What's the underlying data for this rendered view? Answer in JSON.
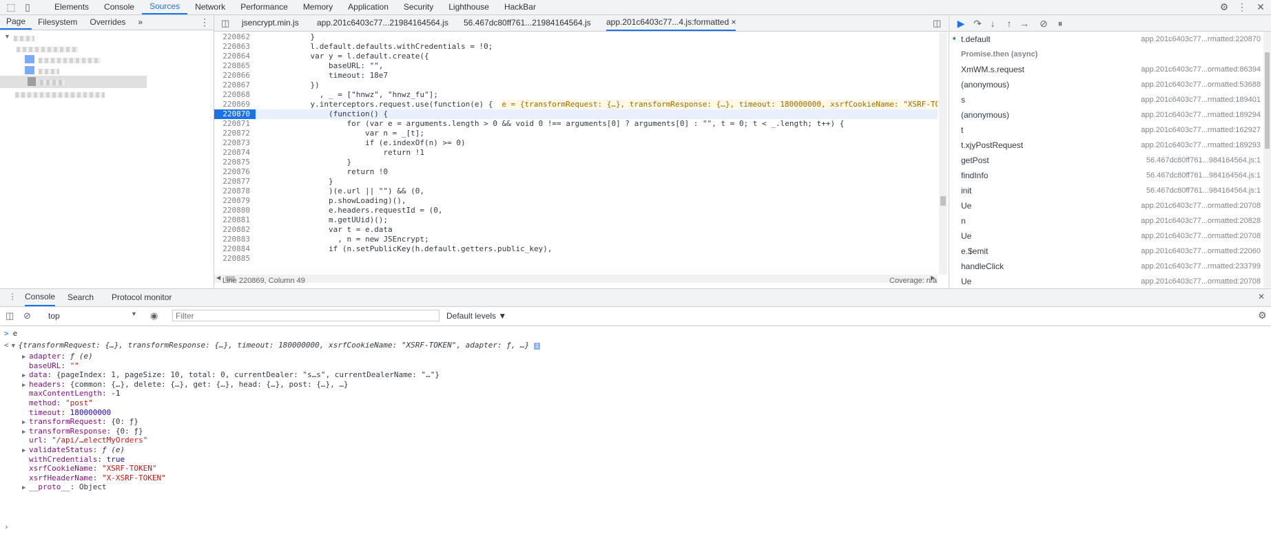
{
  "top_tabs": [
    "Elements",
    "Console",
    "Sources",
    "Network",
    "Performance",
    "Memory",
    "Application",
    "Security",
    "Lighthouse",
    "HackBar"
  ],
  "active_top_tab": "Sources",
  "navigator": {
    "tabs": [
      "Page",
      "Filesystem",
      "Overrides",
      "»"
    ],
    "active": "Page"
  },
  "editor": {
    "file_tabs": [
      "jsencrypt.min.js",
      "app.201c6403c77...21984164564.js",
      "56.467dc80ff761...21984164564.js",
      "app.201c6403c77...4.js:formatted"
    ],
    "active_file": "app.201c6403c77...4.js:formatted",
    "close_glyph": "×",
    "lines": [
      {
        "n": "220862",
        "code": "            }"
      },
      {
        "n": "220863",
        "code": "            l.default.defaults.withCredentials = !0;"
      },
      {
        "n": "220864",
        "code": "            var y = l.default.create({"
      },
      {
        "n": "220865",
        "code": "                baseURL: \"\","
      },
      {
        "n": "220866",
        "code": "                timeout: 18e7"
      },
      {
        "n": "220867",
        "code": "            })"
      },
      {
        "n": "220868",
        "code": "              , _ = [\"hnwz\", \"hnwz_fu\"];"
      },
      {
        "n": "220869",
        "code": "            y.interceptors.request.use(function(e) {"
      },
      {
        "n": "220870",
        "code": "                (function() {"
      },
      {
        "n": "220871",
        "code": "                    for (var e = arguments.length > 0 && void 0 !== arguments[0] ? arguments[0] : \"\", t = 0; t < _.length; t++) {"
      },
      {
        "n": "220872",
        "code": "                        var n = _[t];"
      },
      {
        "n": "220873",
        "code": "                        if (e.indexOf(n) >= 0)"
      },
      {
        "n": "220874",
        "code": "                            return !1"
      },
      {
        "n": "220875",
        "code": "                    }"
      },
      {
        "n": "220876",
        "code": "                    return !0"
      },
      {
        "n": "220877",
        "code": "                }"
      },
      {
        "n": "220878",
        "code": "                )(e.url || \"\") && (0,"
      },
      {
        "n": "220879",
        "code": "                p.showLoading)(),"
      },
      {
        "n": "220880",
        "code": "                e.headers.requestId = (0,"
      },
      {
        "n": "220881",
        "code": "                m.getUUid)();"
      },
      {
        "n": "220882",
        "code": "                var t = e.data"
      },
      {
        "n": "220883",
        "code": "                  , n = new JSEncrypt;"
      },
      {
        "n": "220884",
        "code": "                if (n.setPublicKey(h.default.getters.public_key),"
      },
      {
        "n": "220885",
        "code": ""
      }
    ],
    "paused_line": "220870",
    "inline_value": "e = {transformRequest: {…}, transformResponse: {…}, timeout: 180000000, xsrfCookieName: \"XSRF-TOKEN\"",
    "status_left": "Line 220869, Column 49",
    "status_right": "Coverage: n/a"
  },
  "call_stack": [
    {
      "name": "t.default",
      "loc": "app.201c6403c77...rmatted:220870",
      "current": true
    },
    {
      "name": "Promise.then (async)",
      "loc": "",
      "async": true
    },
    {
      "name": "XmWM.s.request",
      "loc": "app.201c6403c77...ormatted:86394"
    },
    {
      "name": "(anonymous)",
      "loc": "app.201c6403c77...ormatted:53688"
    },
    {
      "name": "s",
      "loc": "app.201c6403c77...rmatted:189401"
    },
    {
      "name": "(anonymous)",
      "loc": "app.201c6403c77...rmatted:189294"
    },
    {
      "name": "t",
      "loc": "app.201c6403c77...rmatted:162927"
    },
    {
      "name": "t.xjyPostRequest",
      "loc": "app.201c6403c77...rmatted:189293"
    },
    {
      "name": "getPost",
      "loc": "56.467dc80ff761...984164564.js:1"
    },
    {
      "name": "findInfo",
      "loc": "56.467dc80ff761...984164564.js:1"
    },
    {
      "name": "init",
      "loc": "56.467dc80ff761...984164564.js:1"
    },
    {
      "name": "Ue",
      "loc": "app.201c6403c77...ormatted:20708"
    },
    {
      "name": "n",
      "loc": "app.201c6403c77...ormatted:20828"
    },
    {
      "name": "Ue",
      "loc": "app.201c6403c77...ormatted:20708"
    },
    {
      "name": "e.$emit",
      "loc": "app.201c6403c77...ormatted:22060"
    },
    {
      "name": "handleClick",
      "loc": "app.201c6403c77...rmatted:233799"
    },
    {
      "name": "Ue",
      "loc": "app.201c6403c77...ormatted:20708"
    }
  ],
  "drawer": {
    "tabs": [
      "Console",
      "Search",
      "Protocol monitor"
    ],
    "active": "Console",
    "context": "top",
    "filter_placeholder": "Filter",
    "levels": "Default levels ▼",
    "input_echo": "e",
    "summary": "{transformRequest: {…}, transformResponse: {…}, timeout: 180000000, xsrfCookieName: \"XSRF-TOKEN\", adapter: ƒ, …}",
    "props": [
      {
        "k": "adapter",
        "v": "ƒ (e)",
        "expand": true
      },
      {
        "k": "baseURL",
        "v": "\"\"",
        "expand": false
      },
      {
        "k": "data",
        "v": "{pageIndex: 1, pageSize: 10, total: 0, currentDealer: \"s…s\", currentDealerName: \"…\"}",
        "expand": true
      },
      {
        "k": "headers",
        "v": "{common: {…}, delete: {…}, get: {…}, head: {…}, post: {…}, …}",
        "expand": true
      },
      {
        "k": "maxContentLength",
        "v": "-1",
        "expand": false
      },
      {
        "k": "method",
        "v": "\"post\"",
        "expand": false
      },
      {
        "k": "timeout",
        "v": "180000000",
        "expand": false
      },
      {
        "k": "transformRequest",
        "v": "{0: ƒ}",
        "expand": true
      },
      {
        "k": "transformResponse",
        "v": "{0: ƒ}",
        "expand": true
      },
      {
        "k": "url",
        "v": "\"/api/…electMyOrders\"",
        "expand": false
      },
      {
        "k": "validateStatus",
        "v": "ƒ (e)",
        "expand": true
      },
      {
        "k": "withCredentials",
        "v": "true",
        "expand": false
      },
      {
        "k": "xsrfCookieName",
        "v": "\"XSRF-TOKEN\"",
        "expand": false
      },
      {
        "k": "xsrfHeaderName",
        "v": "\"X-XSRF-TOKEN\"",
        "expand": false
      },
      {
        "k": "__proto__",
        "v": "Object",
        "expand": true
      }
    ]
  }
}
